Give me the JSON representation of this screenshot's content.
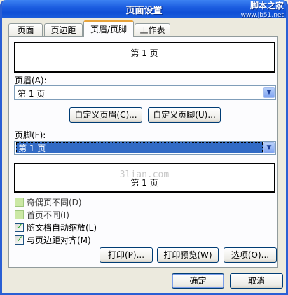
{
  "window": {
    "title": "页面设置",
    "watermark_text": "脚本之家",
    "watermark_url": "www.jb51.net"
  },
  "tabs": [
    {
      "label": "页面"
    },
    {
      "label": "页边距"
    },
    {
      "label": "页眉/页脚"
    },
    {
      "label": "工作表"
    }
  ],
  "header_preview": {
    "text": "第 1 页"
  },
  "header": {
    "label": "页眉(A):",
    "value": "第 1 页",
    "custom_button": "自定义页眉(C)..."
  },
  "footer_custom_button": "自定义页脚(U)...",
  "footer": {
    "label": "页脚(F):",
    "value": "第 1 页"
  },
  "footer_preview": {
    "watermark": "3lian.com",
    "text": "第 1 页"
  },
  "options": [
    {
      "label": "奇偶页不同(D)",
      "checked": false,
      "enabled": false
    },
    {
      "label": "首页不同(I)",
      "checked": false,
      "enabled": false
    },
    {
      "label": "随文档自动缩放(L)",
      "checked": true,
      "enabled": true
    },
    {
      "label": "与页边距对齐(M)",
      "checked": true,
      "enabled": true
    }
  ],
  "actions": {
    "print": "打印(P)...",
    "print_preview": "打印预览(W)",
    "options": "选项(O)..."
  },
  "footer_buttons": {
    "ok": "确定",
    "cancel": "取消"
  },
  "icons": {
    "dropdown": "chevron-down-icon",
    "check": "check-icon"
  }
}
